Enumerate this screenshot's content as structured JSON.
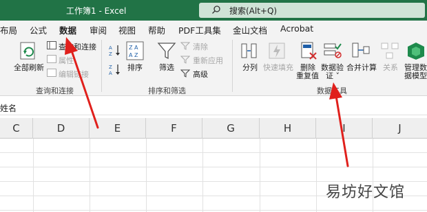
{
  "titlebar": {
    "title": "工作簿1  -  Excel",
    "search_placeholder": "搜索(Alt+Q)"
  },
  "tabs": [
    {
      "label": "布局"
    },
    {
      "label": "公式"
    },
    {
      "label": "数据",
      "active": true
    },
    {
      "label": "审阅"
    },
    {
      "label": "视图"
    },
    {
      "label": "帮助"
    },
    {
      "label": "PDF工具集"
    },
    {
      "label": "金山文档"
    },
    {
      "label": "Acrobat"
    }
  ],
  "ribbon": {
    "query_group": {
      "refresh_all": "全部刷新",
      "queries_connections": "查询和连接",
      "properties": "属性",
      "edit_links": "编辑链接",
      "group_label": "查询和连接"
    },
    "sort_group": {
      "sort": "排序",
      "filter": "筛选",
      "clear": "清除",
      "reapply": "重新应用",
      "advanced": "高级",
      "group_label": "排序和筛选"
    },
    "data_tools_group": {
      "text_to_columns": "分列",
      "flash_fill": "快速填充",
      "remove_duplicates_1": "删除",
      "remove_duplicates_2": "重复值",
      "data_validation_1": "数据验",
      "data_validation_2": "证 ˅",
      "consolidate": "合并计算",
      "relationships": "关系",
      "manage_model_1": "管理数",
      "manage_model_2": "据模型",
      "group_label": "数据工具"
    }
  },
  "namebar": {
    "name_fragment": "姓名"
  },
  "columns": [
    "C",
    "D",
    "E",
    "F",
    "G",
    "H",
    "I",
    "J"
  ],
  "watermark": "易坊好文馆",
  "colors": {
    "brand": "#217346",
    "arrow": "#e0201c"
  }
}
